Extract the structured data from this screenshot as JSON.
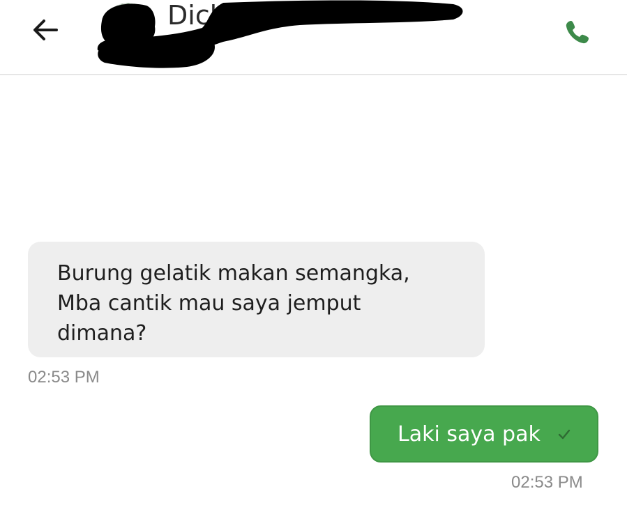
{
  "header": {
    "contact_name": "Dick",
    "back_icon": "arrow-left-icon",
    "call_icon": "phone-icon",
    "accent_color": "#3d8a4a"
  },
  "messages": [
    {
      "direction": "incoming",
      "lines": [
        "Burung gelatik makan semangka,",
        "Mba cantik mau saya jemput",
        "dimana?"
      ],
      "time": "02:53 PM"
    },
    {
      "direction": "outgoing",
      "text": "Laki saya pak",
      "status_icon": "check-icon",
      "time": "02:53 PM",
      "bubble_color": "#47a84e"
    }
  ]
}
